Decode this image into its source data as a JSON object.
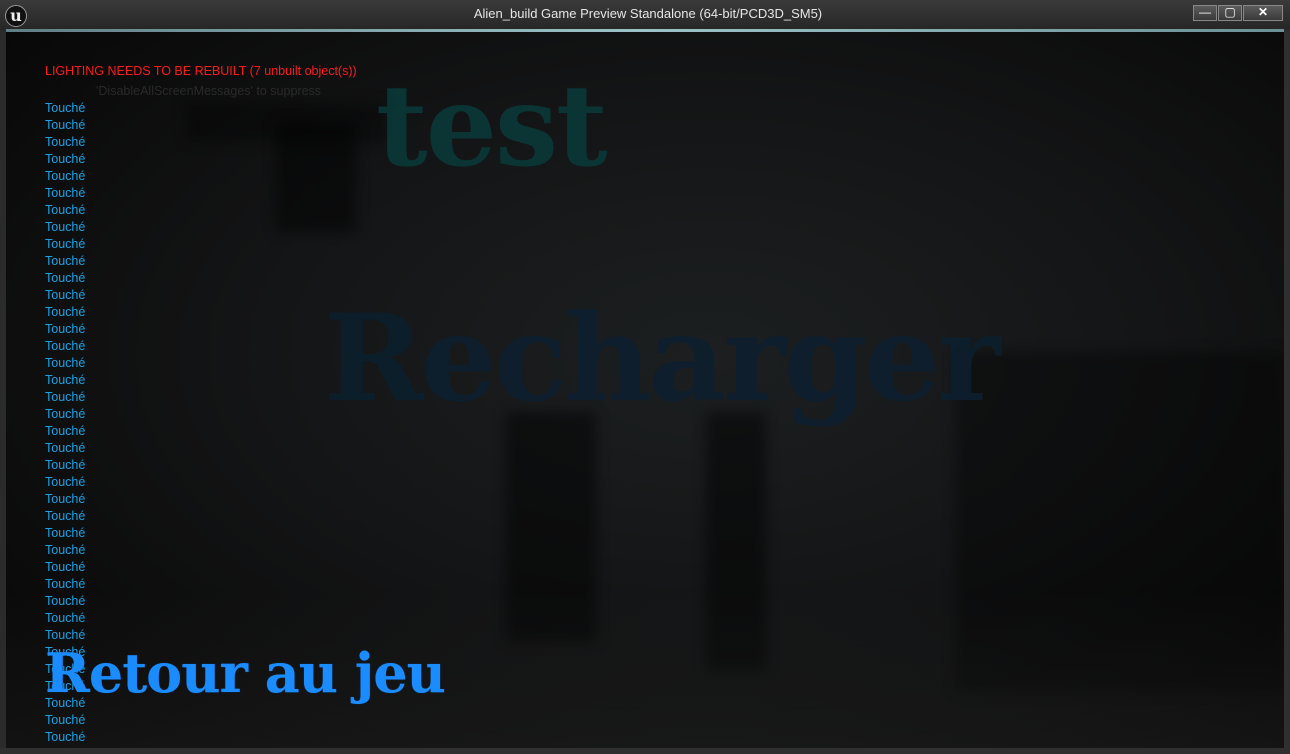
{
  "window": {
    "title": "Alien_build Game Preview Standalone (64-bit/PCD3D_SM5)",
    "logo_glyph": "u",
    "logo_icon": "unreal-engine-logo-icon",
    "buttons": {
      "minimize": "—",
      "maximize": "▢",
      "close": "✕"
    }
  },
  "screen_messages": {
    "lighting_warning": "LIGHTING NEEDS TO BE REBUILT (7 unbuilt object(s))",
    "suppress_hint": "'DisableAllScreenMessages' to suppress",
    "lighting_color": "#ff1a1a",
    "touch_color": "#19a3e6",
    "touch_messages": [
      "Touché",
      "Touché",
      "Touché",
      "Touché",
      "Touché",
      "Touché",
      "Touché",
      "Touché",
      "Touché",
      "Touché",
      "Touché",
      "Touché",
      "Touché",
      "Touché",
      "Touché",
      "Touché",
      "Touché",
      "Touché",
      "Touché",
      "Touché",
      "Touché",
      "Touché",
      "Touché",
      "Touché",
      "Touché",
      "Touché",
      "Touché",
      "Touché",
      "Touché",
      "Touché",
      "Touché",
      "Touché",
      "Touché",
      "Touché",
      "Touché",
      "Touché",
      "Touché",
      "Touché"
    ]
  },
  "scene": {
    "world_text_test": "test",
    "world_text_recharger": "Recharger"
  },
  "menu": {
    "retour_label": "Retour au jeu",
    "retour_color": "#1a8cff"
  }
}
